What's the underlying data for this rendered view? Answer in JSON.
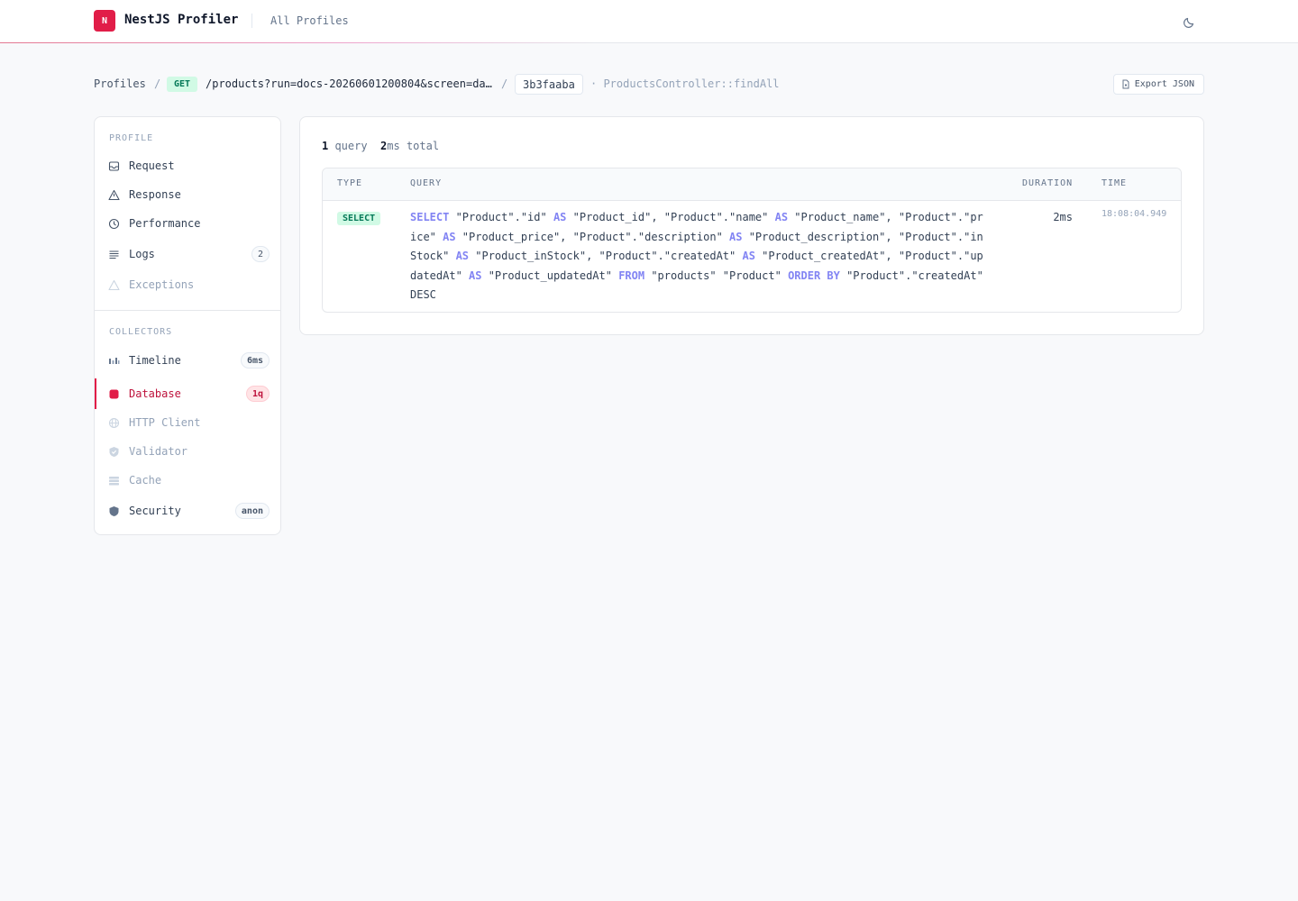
{
  "header": {
    "logo_letter": "N",
    "app_title": "NestJS Profiler",
    "all_profiles": "All Profiles",
    "theme_icon": "moon-icon"
  },
  "breadcrumb": {
    "profiles": "Profiles",
    "sep": "/",
    "method": "GET",
    "path": "/products?run=docs-20260601200804&screen=da…",
    "token": "3b3faaba",
    "controller": "· ProductsController::findAll",
    "export_label": "Export JSON",
    "export_icon": "file-icon"
  },
  "sidebar": {
    "profile_title": "PROFILE",
    "profile_items": [
      {
        "label": "Request",
        "icon": "inbox-icon"
      },
      {
        "label": "Response",
        "icon": "triangle-icon"
      },
      {
        "label": "Performance",
        "icon": "clock-icon"
      },
      {
        "label": "Logs",
        "icon": "list-icon",
        "badge": "2"
      },
      {
        "label": "Exceptions",
        "icon": "warning-icon"
      }
    ],
    "collectors_title": "COLLECTORS",
    "collector_items": [
      {
        "label": "Timeline",
        "icon": "bar-chart-icon",
        "badge": "6ms"
      },
      {
        "label": "Database",
        "icon": "database-icon",
        "badge": "1q"
      },
      {
        "label": "HTTP Client",
        "icon": "globe-icon"
      },
      {
        "label": "Validator",
        "icon": "shield-check-icon"
      },
      {
        "label": "Cache",
        "icon": "stack-icon"
      },
      {
        "label": "Security",
        "icon": "shield-icon",
        "badge": "anon"
      }
    ]
  },
  "main": {
    "query_count": "1",
    "query_label": " query",
    "total_ms": "2",
    "total_label": "ms total",
    "columns": [
      "TYPE",
      "QUERY",
      "DURATION",
      "TIME"
    ],
    "rows": [
      {
        "type": "SELECT",
        "duration": "2ms",
        "time": "18:08:04.949"
      }
    ]
  },
  "colors": {
    "accent": "#e11d48",
    "success_bg": "#d1fae5",
    "success_fg": "#047857",
    "keyword": "#6366f1"
  }
}
